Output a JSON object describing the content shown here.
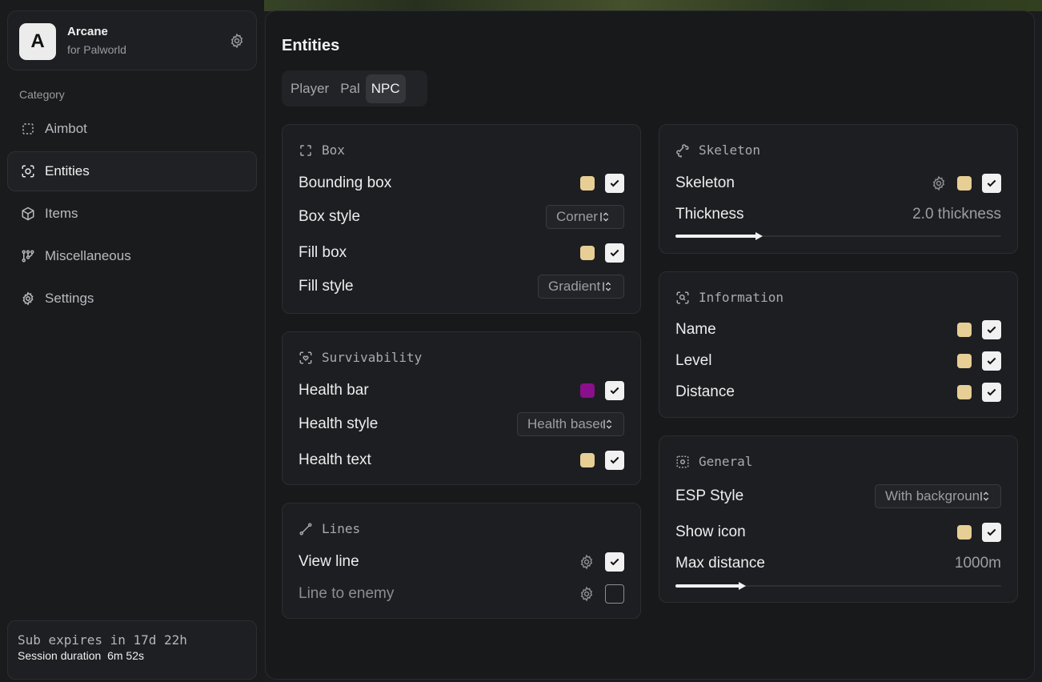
{
  "brand": {
    "logo_letter": "A",
    "title": "Arcane",
    "subtitle": "for Palworld"
  },
  "sidebar": {
    "category_label": "Category",
    "items": [
      {
        "label": "Aimbot",
        "icon": "crosshair-dashed-icon"
      },
      {
        "label": "Entities",
        "icon": "scan-face-icon",
        "active": true
      },
      {
        "label": "Items",
        "icon": "cube-icon"
      },
      {
        "label": "Miscellaneous",
        "icon": "nodes-icon"
      },
      {
        "label": "Settings",
        "icon": "gear-icon"
      }
    ],
    "subscription": "Sub expires in 17d 22h",
    "session_label": "Session duration",
    "session_value": "6m 52s"
  },
  "main": {
    "title": "Entities",
    "tabs": [
      "Player",
      "Pal",
      "NPC"
    ],
    "active_tab": "NPC"
  },
  "colors": {
    "yellow": "#e6ce95",
    "purple": "#8a0f8a"
  },
  "box": {
    "title": "Box",
    "bounding_box": {
      "label": "Bounding box",
      "enabled": true
    },
    "box_style": {
      "label": "Box style",
      "value": "Corner"
    },
    "fill_box": {
      "label": "Fill box",
      "enabled": true
    },
    "fill_style": {
      "label": "Fill style",
      "value": "Gradient"
    }
  },
  "survivability": {
    "title": "Survivability",
    "health_bar": {
      "label": "Health bar",
      "enabled": true
    },
    "health_style": {
      "label": "Health style",
      "value": "Health based"
    },
    "health_text": {
      "label": "Health text",
      "enabled": true
    }
  },
  "lines": {
    "title": "Lines",
    "view_line": {
      "label": "View line",
      "enabled": true
    },
    "line_to_enemy": {
      "label": "Line to enemy",
      "enabled": false
    }
  },
  "skeleton": {
    "title": "Skeleton",
    "skeleton": {
      "label": "Skeleton",
      "enabled": true
    },
    "thickness": {
      "label": "Thickness",
      "value_text": "2.0 thickness",
      "fraction": 0.25
    }
  },
  "information": {
    "title": "Information",
    "name": {
      "label": "Name",
      "enabled": true
    },
    "level": {
      "label": "Level",
      "enabled": true
    },
    "distance": {
      "label": "Distance",
      "enabled": true
    }
  },
  "general": {
    "title": "General",
    "esp_style": {
      "label": "ESP Style",
      "value": "With background"
    },
    "show_icon": {
      "label": "Show icon",
      "enabled": true
    },
    "max_distance": {
      "label": "Max distance",
      "value_text": "1000m",
      "fraction": 0.2
    }
  }
}
